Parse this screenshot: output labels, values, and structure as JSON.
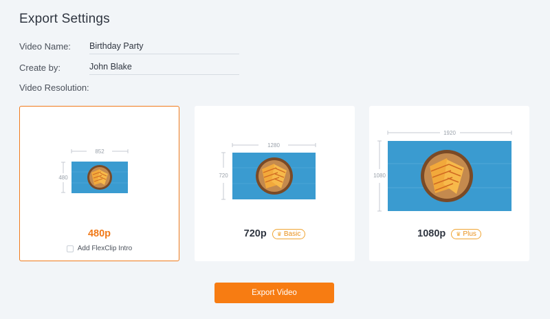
{
  "page": {
    "title": "Export Settings"
  },
  "form": {
    "video_name_label": "Video Name:",
    "video_name_value": "Birthday Party",
    "create_by_label": "Create by:",
    "create_by_value": "John Blake",
    "resolution_label": "Video Resolution:"
  },
  "resolutions": [
    {
      "label": "480p",
      "width": "852",
      "height": "480",
      "selected": true,
      "intro_label": "Add FlexClip Intro"
    },
    {
      "label": "720p",
      "width": "1280",
      "height": "720",
      "selected": false,
      "badge": "Basic",
      "badge_icon": "crown-icon"
    },
    {
      "label": "1080p",
      "width": "1920",
      "height": "1080",
      "selected": false,
      "badge": "Plus",
      "badge_icon": "crown-icon"
    }
  ],
  "actions": {
    "export_label": "Export Video"
  },
  "colors": {
    "accent": "#f77c12",
    "badge_border": "#f0a431",
    "thumbnail_bg": "#3a9bd0",
    "background": "#f2f5f8"
  }
}
